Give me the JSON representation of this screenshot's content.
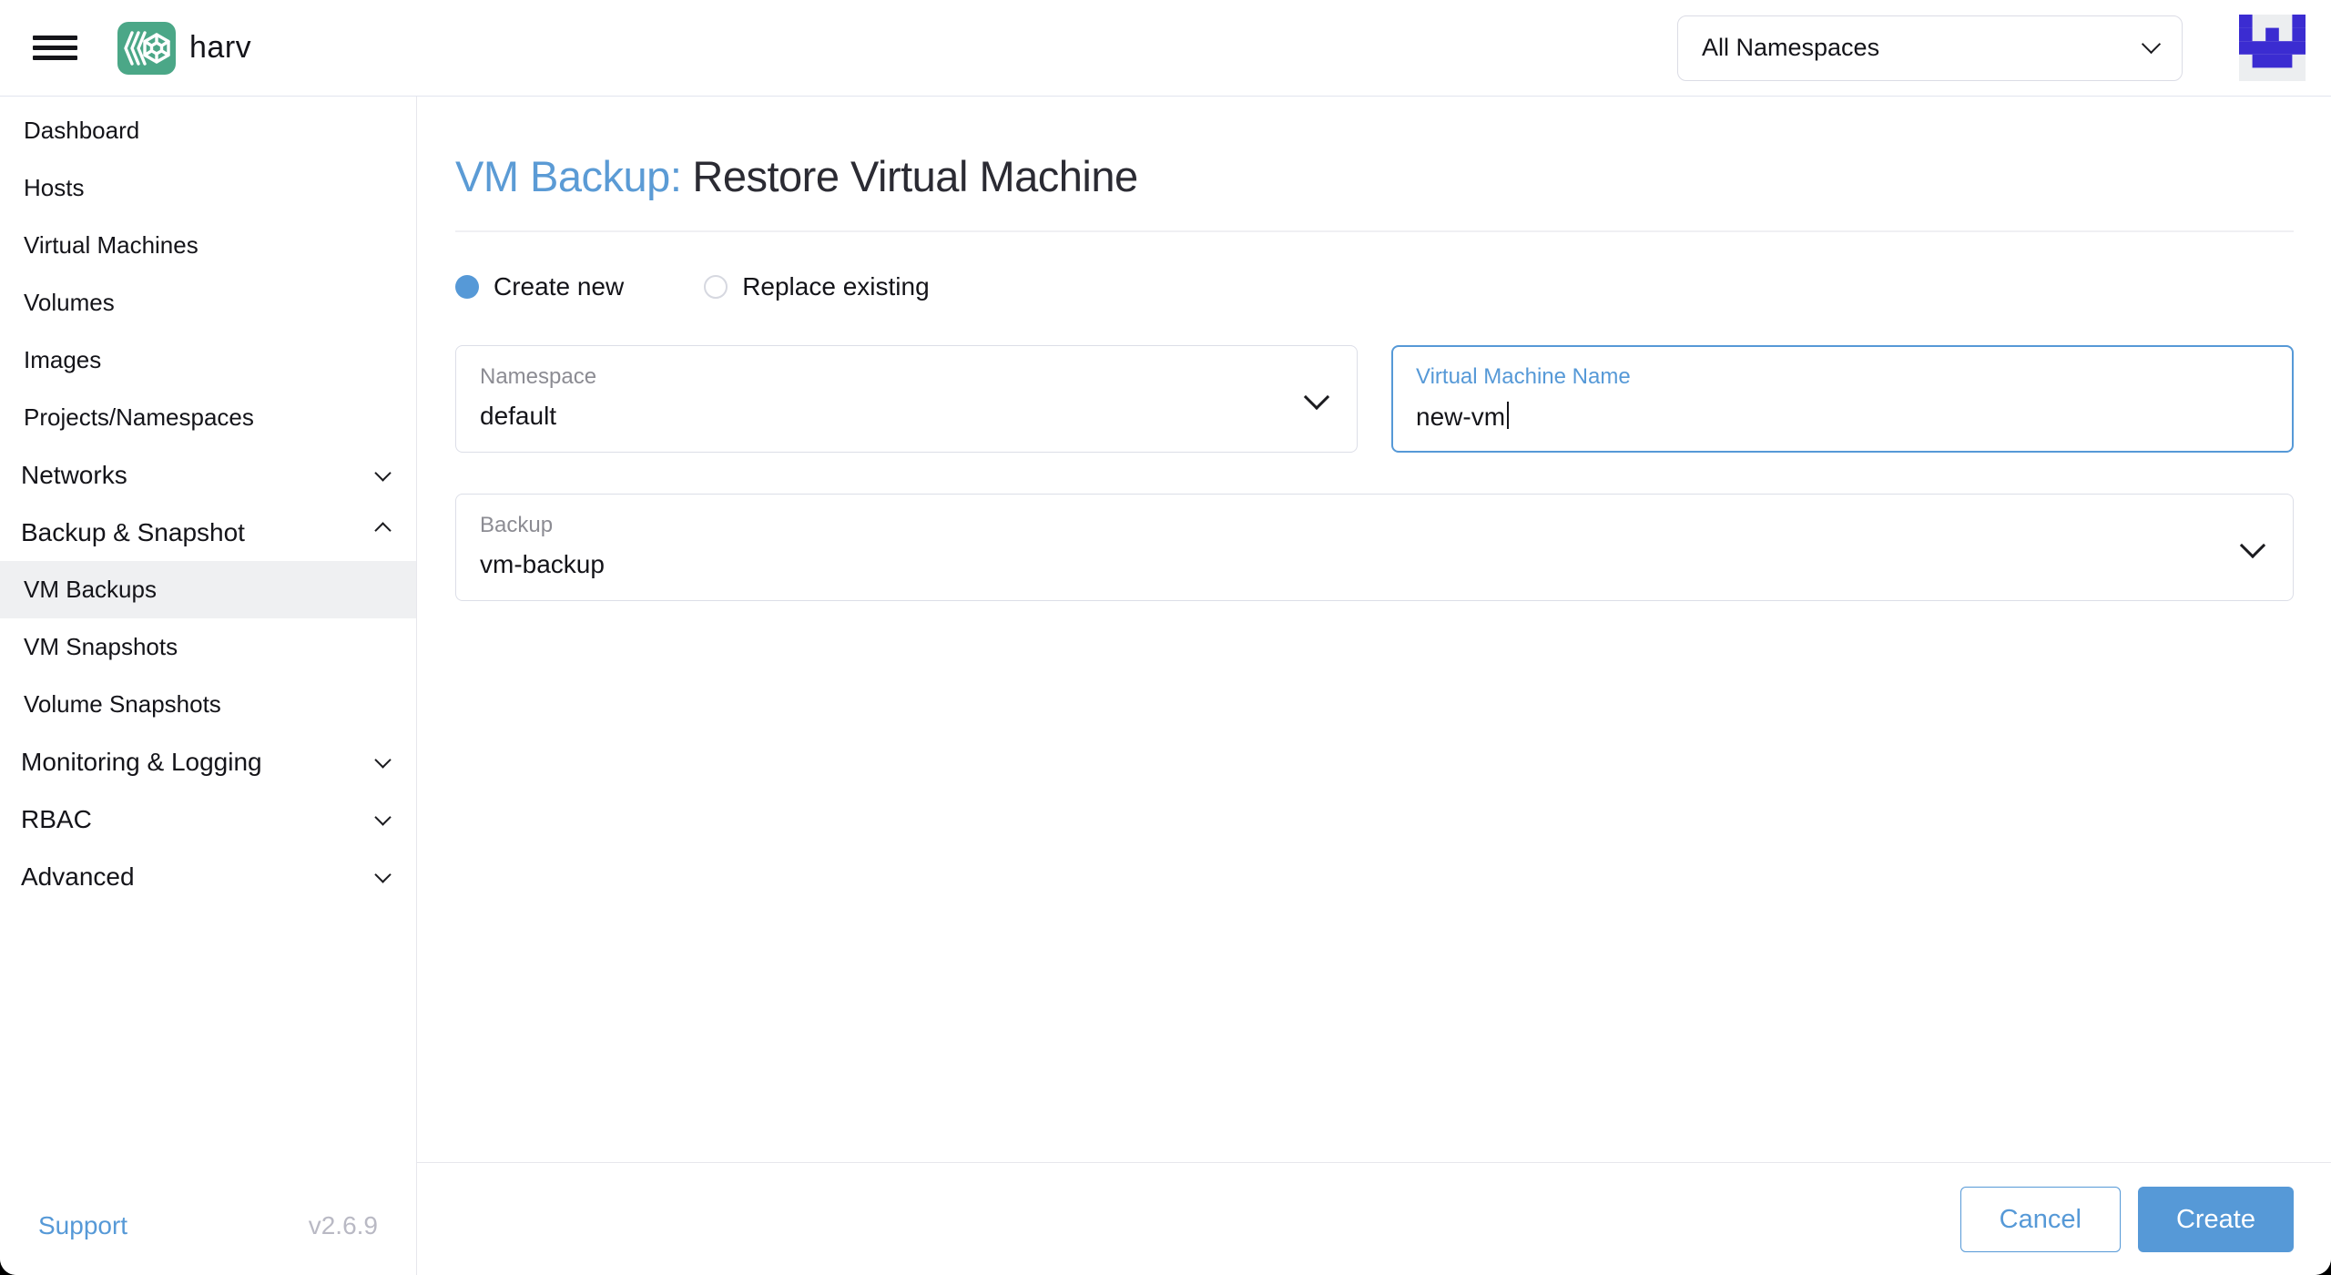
{
  "header": {
    "product_name": "harv",
    "namespace_filter": {
      "value": "All Namespaces"
    }
  },
  "sidebar": {
    "items": [
      {
        "label": "Dashboard",
        "type": "link"
      },
      {
        "label": "Hosts",
        "type": "link"
      },
      {
        "label": "Virtual Machines",
        "type": "link"
      },
      {
        "label": "Volumes",
        "type": "link"
      },
      {
        "label": "Images",
        "type": "link"
      },
      {
        "label": "Projects/Namespaces",
        "type": "link"
      },
      {
        "label": "Networks",
        "type": "group",
        "state": "collapsed"
      },
      {
        "label": "Backup & Snapshot",
        "type": "group",
        "state": "expanded"
      },
      {
        "label": "VM Backups",
        "type": "child",
        "selected": true
      },
      {
        "label": "VM Snapshots",
        "type": "child",
        "selected": false
      },
      {
        "label": "Volume Snapshots",
        "type": "child",
        "selected": false
      },
      {
        "label": "Monitoring & Logging",
        "type": "group",
        "state": "collapsed"
      },
      {
        "label": "RBAC",
        "type": "group",
        "state": "collapsed"
      },
      {
        "label": "Advanced",
        "type": "group",
        "state": "collapsed"
      }
    ],
    "footer": {
      "support_label": "Support",
      "version": "v2.6.9"
    }
  },
  "main": {
    "title_prefix": "VM Backup:",
    "title": "Restore Virtual Machine",
    "radio_options": [
      {
        "label": "Create new",
        "selected": true
      },
      {
        "label": "Replace existing",
        "selected": false
      }
    ],
    "fields": {
      "namespace": {
        "label": "Namespace",
        "value": "default",
        "kind": "select"
      },
      "vm_name": {
        "label": "Virtual Machine Name",
        "value": "new-vm",
        "kind": "text-input",
        "focused": true
      },
      "backup": {
        "label": "Backup",
        "value": "vm-backup",
        "kind": "select"
      }
    },
    "actions": {
      "cancel": "Cancel",
      "create": "Create"
    }
  },
  "icons": {
    "menu": "hamburger",
    "logo": "harvester-hexagon-wheel",
    "namespace_filter": "chevron-down",
    "group_collapsed": "chevron-down",
    "group_expanded": "chevron-up",
    "select_field": "chevron-down",
    "avatar": "pixel-identicon"
  },
  "colors": {
    "primary_blue": "#5699d7",
    "title_link_blue": "#5b9bd5",
    "logo_green": "#4ba787",
    "avatar_purple": "#3b2cd1",
    "avatar_bg": "#eceef0",
    "sidebar_active_bg": "#eff0f2",
    "field_border": "#dcdee7",
    "text_dark": "#141419",
    "label_gray": "#8c8c93",
    "version_gray": "#b9b9c4"
  }
}
